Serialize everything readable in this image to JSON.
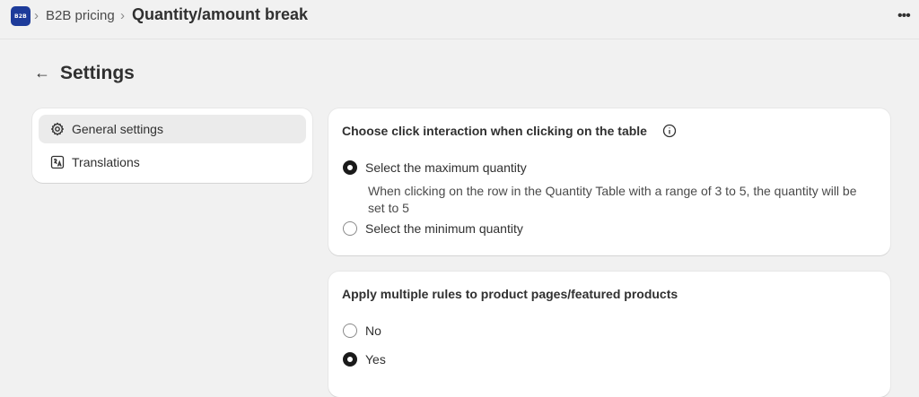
{
  "topbar": {
    "app_logo_text": "B2B",
    "breadcrumb_app": "B2B pricing",
    "breadcrumb_current": "Quantity/amount break",
    "separator": "›",
    "more_label": "•••"
  },
  "page": {
    "back_arrow": "←",
    "title": "Settings"
  },
  "nav": {
    "items": [
      {
        "label": "General settings",
        "icon": "gear-icon",
        "active": true
      },
      {
        "label": "Translations",
        "icon": "translate-icon",
        "active": false
      }
    ]
  },
  "click_interaction": {
    "title": "Choose click interaction when clicking on the table",
    "info_icon": "info-icon",
    "options": [
      {
        "label": "Select the maximum quantity",
        "checked": true
      },
      {
        "label": "Select the minimum quantity",
        "checked": false
      }
    ],
    "help_text": "When clicking on the row in the Quantity Table with a range of 3 to 5, the quantity will be set to 5"
  },
  "multiple_rules": {
    "title": "Apply multiple rules to product pages/featured products",
    "options": [
      {
        "label": "No",
        "checked": false
      },
      {
        "label": "Yes",
        "checked": true
      }
    ]
  },
  "colors": {
    "background": "#f1f1f1",
    "card": "#ffffff",
    "brand": "#1d3b9a",
    "text": "#303030"
  }
}
